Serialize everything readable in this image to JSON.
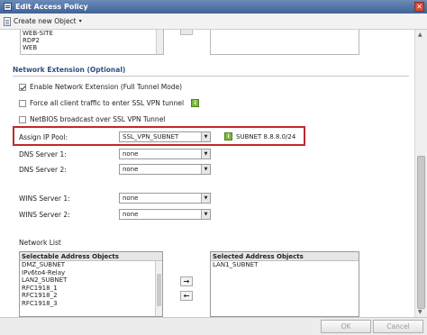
{
  "window": {
    "title": "Edit Access Policy",
    "close_label": "✕"
  },
  "toolbar": {
    "create_label": "Create new Object",
    "caret": "▾"
  },
  "top_list": {
    "items": [
      "WEB-SITE",
      "RDP2",
      "WEB"
    ]
  },
  "section": {
    "title": "Network Extension (Optional)"
  },
  "options": {
    "enable_label": "Enable Network Extension (Full Tunnel Mode)",
    "force_label": "Force all client traffic to enter SSL VPN tunnel",
    "netbios_label": "NetBIOS broadcast over SSL VPN Tunnel",
    "info_glyph": "i"
  },
  "fields": {
    "ip_pool_label": "Assign IP Pool:",
    "ip_pool_value": "SSL_VPN_SUBNET",
    "ip_pool_info": "SUBNET 8.8.8.0/24",
    "dns1_label": "DNS Server 1:",
    "dns1_value": "none",
    "dns2_label": "DNS Server 2:",
    "dns2_value": "none",
    "wins1_label": "WINS Server 1:",
    "wins1_value": "none",
    "wins2_label": "WINS Server 2:",
    "wins2_value": "none",
    "dd_glyph": "▼"
  },
  "network_list": {
    "label": "Network List",
    "selectable_header": "Selectable Address Objects",
    "selectable_items": [
      "DMZ_SUBNET",
      "IPv6to4-Relay",
      "LAN2_SUBNET",
      "RFC1918_1",
      "RFC1918_2",
      "RFC1918_3"
    ],
    "selected_header": "Selected Address Objects",
    "selected_items": [
      "LAN1_SUBNET"
    ],
    "add_glyph": "→",
    "remove_glyph": "←"
  },
  "footer": {
    "ok_label": "OK",
    "cancel_label": "Cancel"
  }
}
